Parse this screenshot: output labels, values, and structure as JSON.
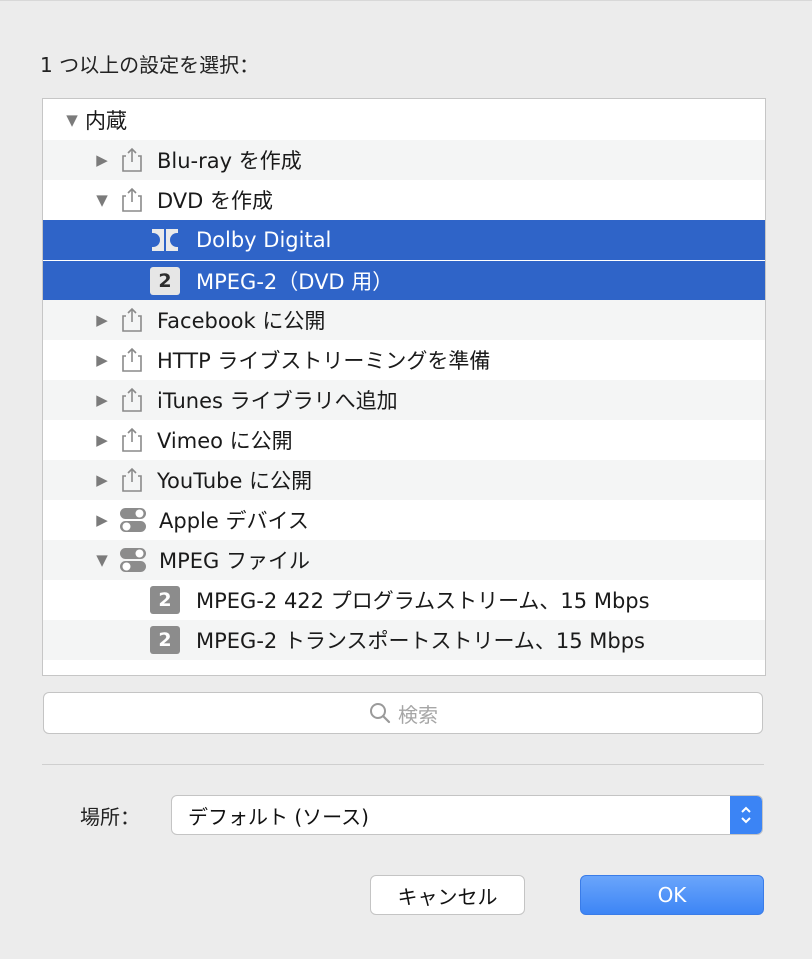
{
  "dialog": {
    "prompt": "1 つ以上の設定を選択：",
    "colors": {
      "selection": "#2f64c8",
      "accent": "#3b84f5"
    }
  },
  "tree": {
    "rows": [
      {
        "label": "内蔵",
        "level": 0,
        "arrow": "▼",
        "icon": "none",
        "state": "expanded"
      },
      {
        "label": "Blu-ray を作成",
        "level": 1,
        "arrow": "▶",
        "icon": "share-icon",
        "state": "collapsed"
      },
      {
        "label": "DVD を作成",
        "level": 1,
        "arrow": "▼",
        "icon": "share-icon",
        "state": "expanded"
      },
      {
        "label": "Dolby Digital",
        "level": 2,
        "icon": "dolby-icon",
        "selected": true
      },
      {
        "label": "MPEG-2（DVD 用）",
        "level": 2,
        "icon": "badge",
        "badge": "2",
        "selected": true
      },
      {
        "label": "Facebook に公開",
        "level": 1,
        "arrow": "▶",
        "icon": "share-icon",
        "state": "collapsed"
      },
      {
        "label": "HTTP ライブストリーミングを準備",
        "level": 1,
        "arrow": "▶",
        "icon": "share-icon",
        "state": "collapsed"
      },
      {
        "label": "iTunes ライブラリへ追加",
        "level": 1,
        "arrow": "▶",
        "icon": "share-icon",
        "state": "collapsed"
      },
      {
        "label": "Vimeo に公開",
        "level": 1,
        "arrow": "▶",
        "icon": "share-icon",
        "state": "collapsed"
      },
      {
        "label": "YouTube に公開",
        "level": 1,
        "arrow": "▶",
        "icon": "share-icon",
        "state": "collapsed"
      },
      {
        "label": "Apple デバイス",
        "level": 1,
        "arrow": "▶",
        "icon": "toggle-icon",
        "state": "collapsed"
      },
      {
        "label": "MPEG ファイル",
        "level": 1,
        "arrow": "▼",
        "icon": "toggle-icon",
        "state": "expanded"
      },
      {
        "label": "MPEG-2 422 プログラムストリーム、15 Mbps",
        "level": 2,
        "icon": "badge",
        "badge": "2"
      },
      {
        "label": "MPEG-2 トランスポートストリーム、15 Mbps",
        "level": 2,
        "icon": "badge",
        "badge": "2"
      }
    ]
  },
  "search": {
    "placeholder": "検索"
  },
  "location": {
    "label": "場所：",
    "value": "デフォルト (ソース)"
  },
  "buttons": {
    "cancel": "キャンセル",
    "ok": "OK"
  }
}
